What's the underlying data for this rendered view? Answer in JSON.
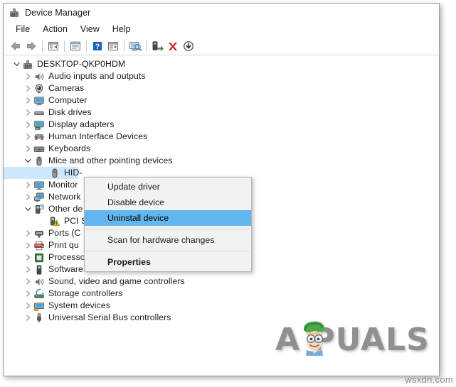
{
  "window": {
    "title": "Device Manager",
    "title_icon": "device-manager-icon"
  },
  "menubar": {
    "items": [
      {
        "label": "File",
        "name": "menu-file"
      },
      {
        "label": "Action",
        "name": "menu-action"
      },
      {
        "label": "View",
        "name": "menu-view"
      },
      {
        "label": "Help",
        "name": "menu-help"
      }
    ]
  },
  "toolbar": {
    "buttons": [
      {
        "name": "back-icon",
        "tip": "Back"
      },
      {
        "name": "forward-icon",
        "tip": "Forward"
      },
      {
        "name": "show-hide-console-tree-icon",
        "tip": "Show/Hide console tree"
      },
      {
        "name": "properties-icon",
        "tip": "Properties"
      },
      {
        "name": "help-icon",
        "tip": "Help"
      },
      {
        "name": "view-devices-icon",
        "tip": "View devices"
      },
      {
        "name": "scan-hardware-changes-icon",
        "tip": "Scan for hardware changes"
      },
      {
        "name": "update-driver-icon",
        "tip": "Update driver"
      },
      {
        "name": "uninstall-device-icon",
        "tip": "Uninstall device"
      },
      {
        "name": "disable-device-icon",
        "tip": "Disable device"
      }
    ]
  },
  "tree": {
    "root": {
      "label": "DESKTOP-QKP0HDM",
      "icon": "computer-root-icon",
      "expanded": true
    },
    "nodes": [
      {
        "label": "Audio inputs and outputs",
        "icon": "speaker-icon",
        "level": 1,
        "expanded": false,
        "selected": false
      },
      {
        "label": "Cameras",
        "icon": "camera-icon",
        "level": 1,
        "expanded": false,
        "selected": false
      },
      {
        "label": "Computer",
        "icon": "monitor-icon",
        "level": 1,
        "expanded": false,
        "selected": false
      },
      {
        "label": "Disk drives",
        "icon": "disk-drive-icon",
        "level": 1,
        "expanded": false,
        "selected": false
      },
      {
        "label": "Display adapters",
        "icon": "display-adapter-icon",
        "level": 1,
        "expanded": false,
        "selected": false
      },
      {
        "label": "Human Interface Devices",
        "icon": "hid-icon",
        "level": 1,
        "expanded": false,
        "selected": false
      },
      {
        "label": "Keyboards",
        "icon": "keyboard-icon",
        "level": 1,
        "expanded": false,
        "selected": false
      },
      {
        "label": "Mice and other pointing devices",
        "icon": "mouse-icon",
        "level": 1,
        "expanded": true,
        "selected": false
      },
      {
        "label": "HID-",
        "icon": "mouse-icon",
        "level": 2,
        "expanded": null,
        "selected": true
      },
      {
        "label": "Monitor",
        "icon": "monitor-icon",
        "level": 1,
        "expanded": false,
        "selected": false
      },
      {
        "label": "Network",
        "icon": "network-adapter-icon",
        "level": 1,
        "expanded": false,
        "selected": false
      },
      {
        "label": "Other de",
        "icon": "unknown-device-icon",
        "level": 1,
        "expanded": true,
        "selected": false
      },
      {
        "label": "PCI S",
        "icon": "warning-device-icon",
        "level": 2,
        "expanded": null,
        "selected": false
      },
      {
        "label": "Ports (C",
        "icon": "port-icon",
        "level": 1,
        "expanded": false,
        "selected": false
      },
      {
        "label": "Print qu",
        "icon": "printer-icon",
        "level": 1,
        "expanded": false,
        "selected": false
      },
      {
        "label": "Processors",
        "icon": "processor-icon",
        "level": 1,
        "expanded": false,
        "selected": false
      },
      {
        "label": "Software devices",
        "icon": "software-device-icon",
        "level": 1,
        "expanded": false,
        "selected": false
      },
      {
        "label": "Sound, video and game controllers",
        "icon": "speaker-icon",
        "level": 1,
        "expanded": false,
        "selected": false
      },
      {
        "label": "Storage controllers",
        "icon": "storage-controller-icon",
        "level": 1,
        "expanded": false,
        "selected": false
      },
      {
        "label": "System devices",
        "icon": "system-device-icon",
        "level": 1,
        "expanded": false,
        "selected": false
      },
      {
        "label": "Universal Serial Bus controllers",
        "icon": "usb-icon",
        "level": 1,
        "expanded": false,
        "selected": false
      }
    ]
  },
  "context_menu": {
    "items": [
      {
        "label": "Update driver",
        "name": "ctx-update-driver",
        "highlighted": false,
        "bold": false
      },
      {
        "label": "Disable device",
        "name": "ctx-disable-device",
        "highlighted": false,
        "bold": false
      },
      {
        "label": "Uninstall device",
        "name": "ctx-uninstall-device",
        "highlighted": true,
        "bold": false
      },
      {
        "separator": true
      },
      {
        "label": "Scan for hardware changes",
        "name": "ctx-scan-hardware-changes",
        "highlighted": false,
        "bold": false
      },
      {
        "separator": true
      },
      {
        "label": "Properties",
        "name": "ctx-properties",
        "highlighted": false,
        "bold": true
      }
    ]
  },
  "watermark": {
    "text": "A  PUALS",
    "site_tag": "wsxdn.com"
  },
  "colors": {
    "selection_blue": "#cce8ff",
    "menu_highlight_blue": "#63b7ef",
    "window_border": "#9a9a9a",
    "menu_bg": "#f2f2f2",
    "text": "#1b1b1b"
  }
}
